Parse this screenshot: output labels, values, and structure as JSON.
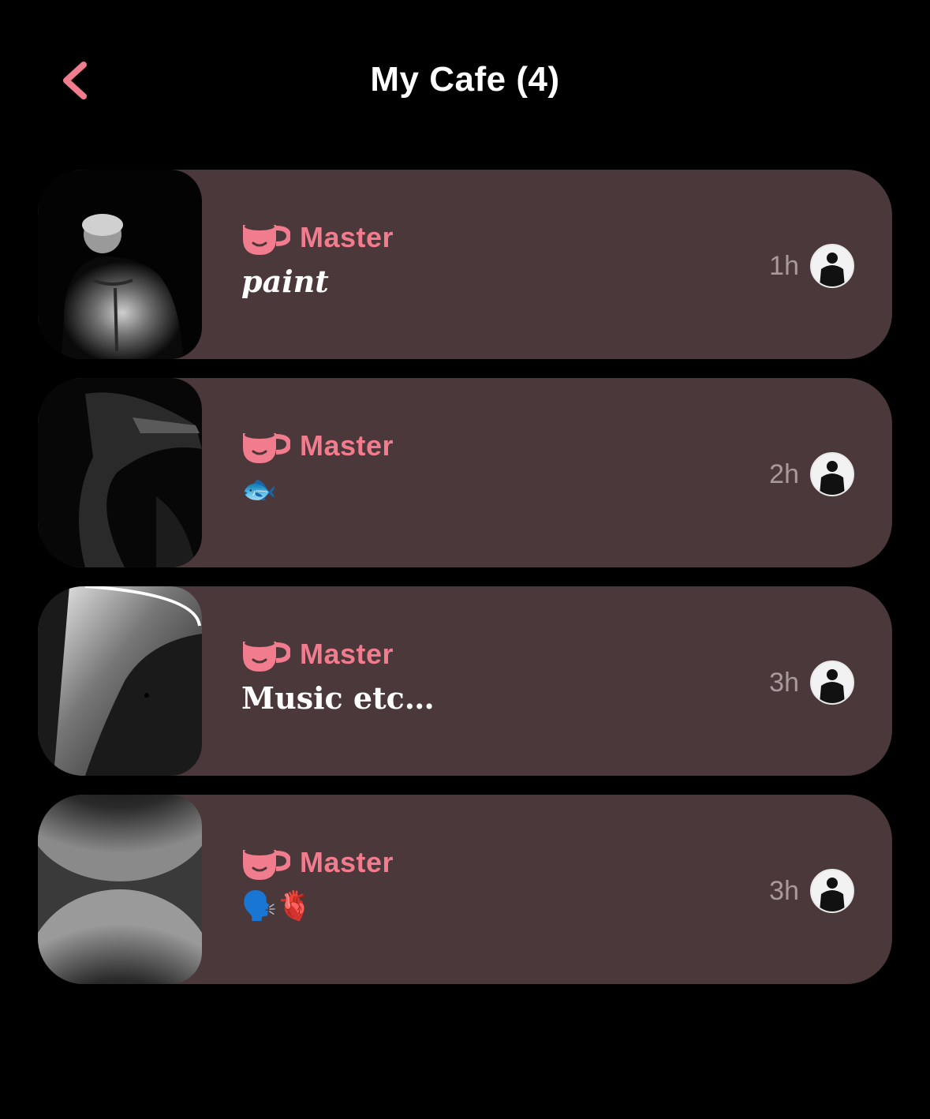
{
  "header": {
    "title": "My Cafe (4)",
    "back_icon": "chevron-left-icon"
  },
  "colors": {
    "background": "#000000",
    "card": "#4b383b",
    "accent": "#f07c8d",
    "time_text": "#a89a9c"
  },
  "cafes": [
    {
      "author": "Master",
      "author_icon": "coffee-cup-icon",
      "title": "paint",
      "time": "1h",
      "thumbnail": "statue-back-image"
    },
    {
      "author": "Master",
      "author_icon": "coffee-cup-icon",
      "title": "🐟",
      "time": "2h",
      "thumbnail": "dark-figure-image"
    },
    {
      "author": "Master",
      "author_icon": "coffee-cup-icon",
      "title": "Music etc…",
      "time": "3h",
      "thumbnail": "light-beam-image"
    },
    {
      "author": "Master",
      "author_icon": "coffee-cup-icon",
      "title": "🗣️🫀",
      "time": "3h",
      "thumbnail": "abstract-curves-image"
    }
  ]
}
